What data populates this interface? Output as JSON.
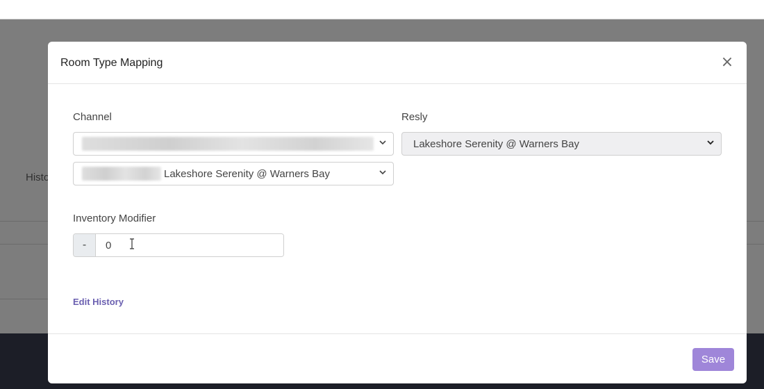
{
  "background": {
    "partial_text": "Histo"
  },
  "modal": {
    "title": "Room Type Mapping",
    "close_label": "×",
    "channel": {
      "label": "Channel",
      "select_1_value": "",
      "select_2_value": "Lakeshore Serenity @ Warners Bay"
    },
    "resly": {
      "label": "Resly",
      "select_value": "Lakeshore Serenity @ Warners Bay"
    },
    "inventory_modifier": {
      "label": "Inventory Modifier",
      "minus_label": "-",
      "value": "0"
    },
    "edit_history_label": "Edit History",
    "save_label": "Save"
  },
  "colors": {
    "accent": "#9f86d9",
    "link": "#6a5fb0",
    "overlay": "#7d7d7d",
    "footer_dark": "#1c1e27"
  },
  "icons": {
    "close": "close-icon",
    "select_arrow": "chevron-down-icon",
    "text_cursor": "text-cursor-icon"
  }
}
